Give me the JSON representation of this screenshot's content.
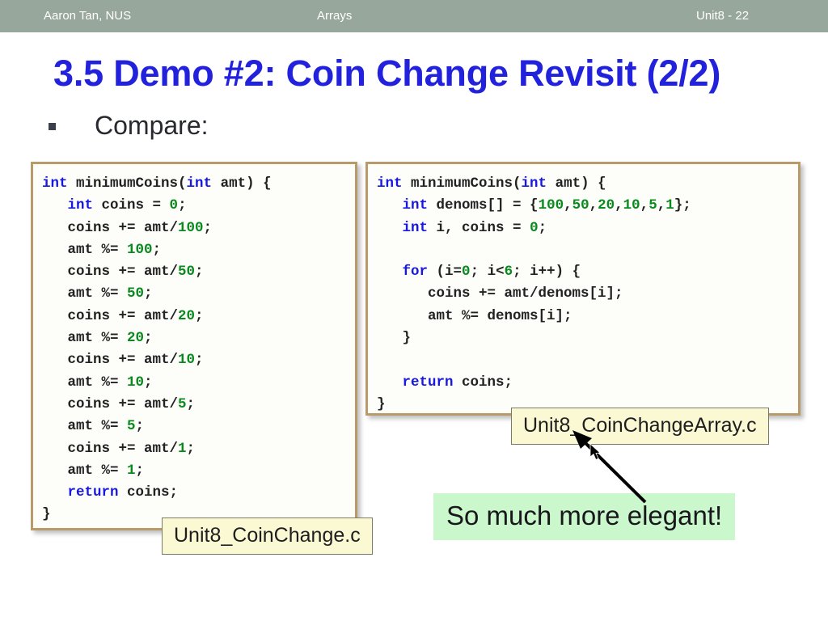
{
  "header": {
    "author": "Aaron Tan, NUS",
    "topic": "Arrays",
    "page": "Unit8 - 22",
    "band_color": "#98a79b",
    "text_color": "#ffffff"
  },
  "title": {
    "text": "3.5 Demo #2: Coin Change Revisit (2/2)",
    "color": "#2222dd"
  },
  "bullet": {
    "marker": "square-bullet",
    "text": "Compare:"
  },
  "code_left": {
    "language": "c",
    "file_label": "Unit8_CoinChange.c",
    "lines": [
      [
        {
          "t": "int",
          "c": "kw"
        },
        {
          "t": " minimumCoins(",
          "c": ""
        },
        {
          "t": "int",
          "c": "kw"
        },
        {
          "t": " amt) {",
          "c": ""
        }
      ],
      [
        {
          "t": "   ",
          "c": ""
        },
        {
          "t": "int",
          "c": "kw"
        },
        {
          "t": " coins = ",
          "c": ""
        },
        {
          "t": "0",
          "c": "num"
        },
        {
          "t": ";",
          "c": ""
        }
      ],
      [
        {
          "t": "   coins += amt/",
          "c": ""
        },
        {
          "t": "100",
          "c": "num"
        },
        {
          "t": ";",
          "c": ""
        }
      ],
      [
        {
          "t": "   amt %= ",
          "c": ""
        },
        {
          "t": "100",
          "c": "num"
        },
        {
          "t": ";",
          "c": ""
        }
      ],
      [
        {
          "t": "   coins += amt/",
          "c": ""
        },
        {
          "t": "50",
          "c": "num"
        },
        {
          "t": ";",
          "c": ""
        }
      ],
      [
        {
          "t": "   amt %= ",
          "c": ""
        },
        {
          "t": "50",
          "c": "num"
        },
        {
          "t": ";",
          "c": ""
        }
      ],
      [
        {
          "t": "   coins += amt/",
          "c": ""
        },
        {
          "t": "20",
          "c": "num"
        },
        {
          "t": ";",
          "c": ""
        }
      ],
      [
        {
          "t": "   amt %= ",
          "c": ""
        },
        {
          "t": "20",
          "c": "num"
        },
        {
          "t": ";",
          "c": ""
        }
      ],
      [
        {
          "t": "   coins += amt/",
          "c": ""
        },
        {
          "t": "10",
          "c": "num"
        },
        {
          "t": ";",
          "c": ""
        }
      ],
      [
        {
          "t": "   amt %= ",
          "c": ""
        },
        {
          "t": "10",
          "c": "num"
        },
        {
          "t": ";",
          "c": ""
        }
      ],
      [
        {
          "t": "   coins += amt/",
          "c": ""
        },
        {
          "t": "5",
          "c": "num"
        },
        {
          "t": ";",
          "c": ""
        }
      ],
      [
        {
          "t": "   amt %= ",
          "c": ""
        },
        {
          "t": "5",
          "c": "num"
        },
        {
          "t": ";",
          "c": ""
        }
      ],
      [
        {
          "t": "   coins += amt/",
          "c": ""
        },
        {
          "t": "1",
          "c": "num"
        },
        {
          "t": ";",
          "c": ""
        }
      ],
      [
        {
          "t": "   amt %= ",
          "c": ""
        },
        {
          "t": "1",
          "c": "num"
        },
        {
          "t": ";",
          "c": ""
        }
      ],
      [
        {
          "t": "   ",
          "c": ""
        },
        {
          "t": "return",
          "c": "kw"
        },
        {
          "t": " coins;",
          "c": ""
        }
      ],
      [
        {
          "t": "}",
          "c": ""
        }
      ]
    ]
  },
  "code_right": {
    "language": "c",
    "file_label": "Unit8_CoinChangeArray.c",
    "lines": [
      [
        {
          "t": "int",
          "c": "kw"
        },
        {
          "t": " minimumCoins(",
          "c": ""
        },
        {
          "t": "int",
          "c": "kw"
        },
        {
          "t": " amt) {",
          "c": ""
        }
      ],
      [
        {
          "t": "   ",
          "c": ""
        },
        {
          "t": "int",
          "c": "kw"
        },
        {
          "t": " denoms[] = {",
          "c": ""
        },
        {
          "t": "100",
          "c": "num"
        },
        {
          "t": ",",
          "c": ""
        },
        {
          "t": "50",
          "c": "num"
        },
        {
          "t": ",",
          "c": ""
        },
        {
          "t": "20",
          "c": "num"
        },
        {
          "t": ",",
          "c": ""
        },
        {
          "t": "10",
          "c": "num"
        },
        {
          "t": ",",
          "c": ""
        },
        {
          "t": "5",
          "c": "num"
        },
        {
          "t": ",",
          "c": ""
        },
        {
          "t": "1",
          "c": "num"
        },
        {
          "t": "};",
          "c": ""
        }
      ],
      [
        {
          "t": "   ",
          "c": ""
        },
        {
          "t": "int",
          "c": "kw"
        },
        {
          "t": " i, coins = ",
          "c": ""
        },
        {
          "t": "0",
          "c": "num"
        },
        {
          "t": ";",
          "c": ""
        }
      ],
      [
        {
          "t": "",
          "c": ""
        }
      ],
      [
        {
          "t": "   ",
          "c": ""
        },
        {
          "t": "for",
          "c": "kw"
        },
        {
          "t": " (i=",
          "c": ""
        },
        {
          "t": "0",
          "c": "num"
        },
        {
          "t": "; i<",
          "c": ""
        },
        {
          "t": "6",
          "c": "num"
        },
        {
          "t": "; i++) {",
          "c": ""
        }
      ],
      [
        {
          "t": "      coins += amt/denoms[i];",
          "c": ""
        }
      ],
      [
        {
          "t": "      amt %= denoms[i];",
          "c": ""
        }
      ],
      [
        {
          "t": "   }",
          "c": ""
        }
      ],
      [
        {
          "t": "",
          "c": ""
        }
      ],
      [
        {
          "t": "   ",
          "c": ""
        },
        {
          "t": "return",
          "c": "kw"
        },
        {
          "t": " coins;",
          "c": ""
        }
      ],
      [
        {
          "t": "}",
          "c": ""
        }
      ]
    ]
  },
  "comment": {
    "text": "So much more elegant!",
    "background": "#caf7cb"
  },
  "annotation": {
    "arrow": "arrow-up-left"
  },
  "cursor": {
    "kind": "mouse-pointer"
  }
}
